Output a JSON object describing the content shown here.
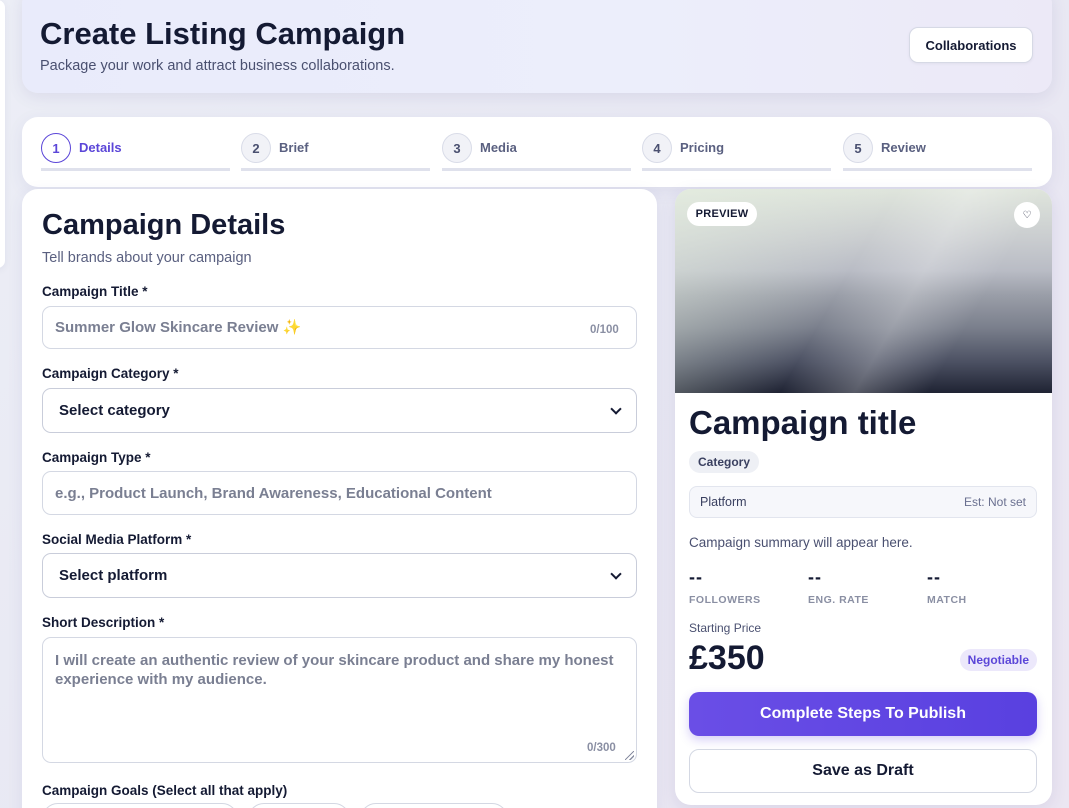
{
  "header": {
    "title": "Create Listing Campaign",
    "subtitle": "Package your work and attract business collaborations.",
    "collaborations_label": "Collaborations"
  },
  "stepper": {
    "steps": [
      {
        "number": "1",
        "label": "Details",
        "active": true
      },
      {
        "number": "2",
        "label": "Brief",
        "active": false
      },
      {
        "number": "3",
        "label": "Media",
        "active": false
      },
      {
        "number": "4",
        "label": "Pricing",
        "active": false
      },
      {
        "number": "5",
        "label": "Review",
        "active": false
      }
    ]
  },
  "form": {
    "title": "Campaign Details",
    "subtitle": "Tell brands about your campaign",
    "campaign_title": {
      "label": "Campaign Title *",
      "placeholder": "Summer Glow Skincare Review ✨",
      "value": "",
      "count": "0/100"
    },
    "category": {
      "label": "Campaign Category *",
      "selected": "Select category"
    },
    "type": {
      "label": "Campaign Type *",
      "placeholder": "e.g., Product Launch, Brand Awareness, Educational Content",
      "value": ""
    },
    "platform": {
      "label": "Social Media Platform *",
      "selected": "Select platform"
    },
    "description": {
      "label": "Short Description *",
      "placeholder": "I will create an authentic review of your skincare product and share my honest experience with my audience.",
      "value": "",
      "count": "0/300"
    },
    "goals": {
      "label": "Campaign Goals (Select all that apply)"
    }
  },
  "preview": {
    "badge": "PREVIEW",
    "heart_icon": "heart-icon",
    "title": "Campaign title",
    "category": "Category",
    "platform": "Platform",
    "estimate": "Est: Not set",
    "summary": "Campaign summary will appear here.",
    "stats": [
      {
        "value": "--",
        "label": "FOLLOWERS"
      },
      {
        "value": "--",
        "label": "ENG. RATE"
      },
      {
        "value": "--",
        "label": "MATCH"
      }
    ],
    "price_label": "Starting Price",
    "price": "£350",
    "negotiable": "Negotiable",
    "publish_label": "Complete Steps To Publish",
    "draft_label": "Save as Draft"
  },
  "colors": {
    "accent": "#5b46d8",
    "text": "#141a33"
  }
}
